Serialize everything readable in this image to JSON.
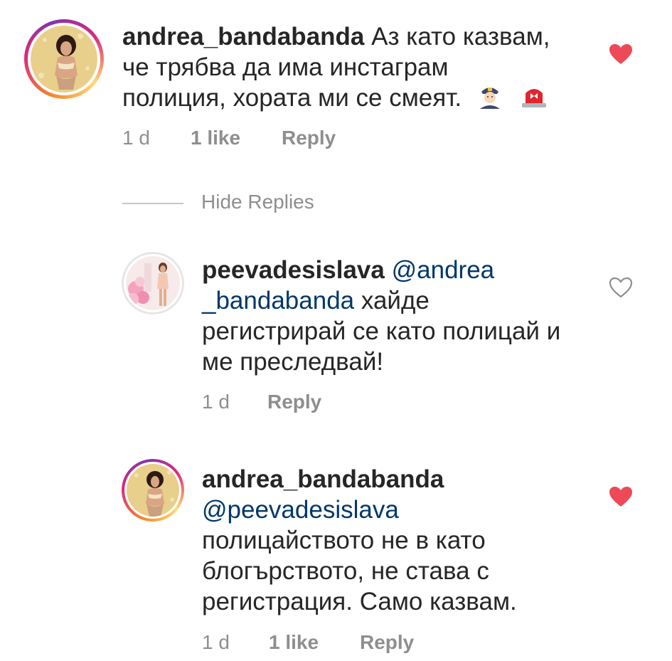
{
  "comments": [
    {
      "username": "andrea_bandabanda",
      "text_lines": [
        "Аз като казвам,",
        "че трябва да има инстаграм",
        "полиция, хората ми се смеят."
      ],
      "emojis": [
        "police-officer-emoji",
        "rotating-light-emoji"
      ],
      "time": "1 d",
      "likes": "1 like",
      "reply": "Reply",
      "liked": true
    },
    {
      "username": "peevadesislava",
      "mention_part1": "@andrea",
      "mention_part2": "_bandabanda",
      "text_line2_rest": "хайде",
      "text_line3": "регистрирай се като полицай и",
      "text_line4": "ме преследвай!",
      "time": "1 d",
      "reply": "Reply",
      "liked": false
    },
    {
      "username": "andrea_bandabanda",
      "mention": "@peevadesislava",
      "text_lines": [
        "полицайството не в като",
        "блогърството, не става с",
        "регистрация. Само казвам."
      ],
      "time": "1 d",
      "likes": "1 like",
      "reply": "Reply",
      "liked": true
    }
  ],
  "hide_replies": "Hide Replies",
  "colors": {
    "text": "#262626",
    "meta": "#8e8e8e",
    "mention": "#00376b",
    "heart_liked": "#ed4956"
  }
}
